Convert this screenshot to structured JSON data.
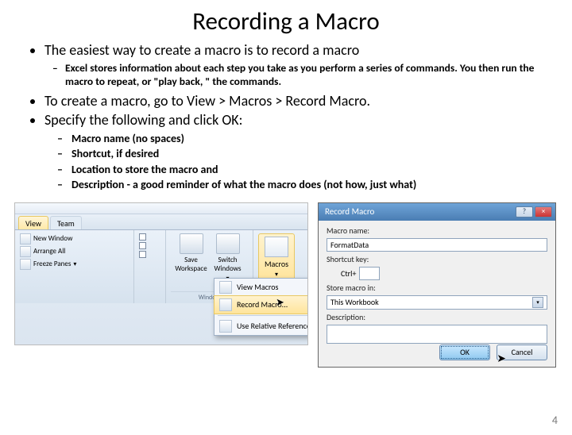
{
  "title": "Recording a Macro",
  "bullets": {
    "b1": "The easiest way to create a macro is to record a macro",
    "b1a": "Excel stores information about each step you take as you perform a series of commands. You then run the macro to repeat, or \"play back, \" the commands.",
    "b2": "To create a macro, go to View > Macros > Record Macro.",
    "b3": "Specify the following and click OK:",
    "b3a": "Macro name (no spaces)",
    "b3b": "Shortcut, if desired",
    "b3c": "Location to store the macro and",
    "b3d": "Description  - a good reminder of what the macro does (not how, just what)"
  },
  "ribbon": {
    "tab_view": "View",
    "tab_team": "Team",
    "new_window": "New Window",
    "arrange_all": "Arrange All",
    "freeze_panes": "Freeze Panes",
    "save_workspace": "Save Workspace",
    "switch_windows": "Switch Windows",
    "window_group": "Window",
    "macros": "Macros",
    "dd_view_macros": "View Macros",
    "dd_record_macro": "Record Macro...",
    "dd_use_relative": "Use Relative References"
  },
  "dialog": {
    "title": "Record Macro",
    "help": "?",
    "close": "×",
    "macro_name_label": "Macro name:",
    "macro_name_value": "FormatData",
    "shortcut_label": "Shortcut key:",
    "ctrl": "Ctrl+",
    "store_label": "Store macro in:",
    "store_value": "This Workbook",
    "description_label": "Description:",
    "ok": "OK",
    "cancel": "Cancel"
  },
  "page_number": "4"
}
